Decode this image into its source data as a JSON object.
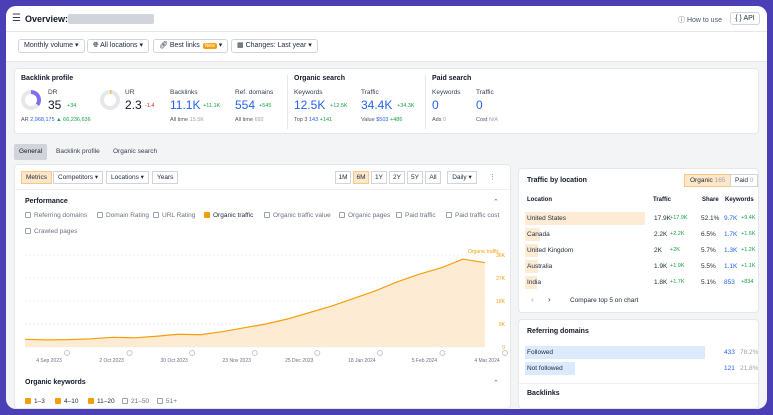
{
  "header": {
    "title": "Overview:",
    "how_to_use": "How to use",
    "api": "{ } API"
  },
  "filters": {
    "volume": "Monthly volume",
    "locations": "All locations",
    "best_links": "Best links",
    "new_badge": "New",
    "changes": "Changes: Last year"
  },
  "backlink_profile": {
    "title": "Backlink profile",
    "dr_label": "DR",
    "dr_value": "35",
    "dr_delta": "+34",
    "ar_label": "AR",
    "ar_value": "2,968,175",
    "ar_delta": "▲ 66,236,636",
    "ur_label": "UR",
    "ur_value": "2.3",
    "ur_delta": "-1.4",
    "backlinks_label": "Backlinks",
    "backlinks_value": "11.1K",
    "backlinks_delta": "+11.1K",
    "backlinks_sub": "All time",
    "backlinks_sub_value": "15.5K",
    "refdomains_label": "Ref. domains",
    "refdomains_value": "554",
    "refdomains_delta": "+545",
    "refdomains_sub": "All time",
    "refdomains_sub_value": "692"
  },
  "organic_search": {
    "title": "Organic search",
    "keywords_label": "Keywords",
    "keywords_value": "12.5K",
    "keywords_delta": "+12.5K",
    "keywords_sub": "Top 3",
    "keywords_sub_value": "143",
    "keywords_sub_delta": "+141",
    "traffic_label": "Traffic",
    "traffic_value": "34.4K",
    "traffic_delta": "+34.3K",
    "traffic_sub": "Value",
    "traffic_sub_value": "$503",
    "traffic_sub_delta": "+486"
  },
  "paid_search": {
    "title": "Paid search",
    "keywords_label": "Keywords",
    "keywords_value": "0",
    "keywords_sub": "Ads",
    "keywords_sub_value": "0",
    "traffic_label": "Traffic",
    "traffic_value": "0",
    "traffic_sub": "Cost",
    "traffic_sub_value": "N/A"
  },
  "tabs": [
    "General",
    "Backlink profile",
    "Organic search"
  ],
  "chart_toolbar": {
    "metrics": "Metrics",
    "competitors": "Competitors",
    "locations": "Locations",
    "years": "Years",
    "ranges": [
      "1M",
      "6M",
      "1Y",
      "2Y",
      "5Y",
      "All"
    ],
    "active_range": "6M",
    "interval": "Daily"
  },
  "performance": {
    "title": "Performance",
    "checkboxes": [
      {
        "label": "Referring domains",
        "checked": false
      },
      {
        "label": "Domain Rating",
        "checked": false
      },
      {
        "label": "URL Rating",
        "checked": false
      },
      {
        "label": "Organic traffic",
        "checked": true
      },
      {
        "label": "Organic traffic value",
        "checked": false
      },
      {
        "label": "Organic pages",
        "checked": false
      },
      {
        "label": "Paid traffic",
        "checked": false
      },
      {
        "label": "Paid traffic cost",
        "checked": false
      },
      {
        "label": "Crawled pages",
        "checked": false
      }
    ]
  },
  "chart_data": {
    "type": "area",
    "series": [
      {
        "name": "Organic traffic",
        "values": [
          3000,
          2800,
          2900,
          3200,
          3800,
          3600,
          4200,
          5000,
          4800,
          6000,
          7500,
          9000,
          11000,
          13500,
          16000,
          19000,
          22000,
          25500,
          28500,
          31000,
          34400,
          33000
        ]
      }
    ],
    "x_ticks": [
      "4 Sep 2023",
      "2 Oct 2023",
      "30 Oct 2023",
      "23 Nov 2023",
      "25 Dec 2023",
      "18 Jan 2024",
      "5 Feb 2024",
      "4 Mar 2024"
    ],
    "y_ticks": [
      "36K",
      "27K",
      "18K",
      "9K",
      "0"
    ],
    "ylim": [
      0,
      36000
    ],
    "color": "#f59e0b",
    "grid": true
  },
  "organic_keywords": {
    "title": "Organic keywords",
    "checkboxes": [
      {
        "label": "1–3",
        "checked": true
      },
      {
        "label": "4–10",
        "checked": true
      },
      {
        "label": "11–20",
        "checked": true
      },
      {
        "label": "21–50",
        "checked": false
      },
      {
        "label": "51+",
        "checked": false
      }
    ]
  },
  "traffic_by_location": {
    "title": "Traffic by location",
    "organic_btn": "Organic",
    "organic_count": "165",
    "paid_btn": "Paid",
    "paid_count": "0",
    "headers": [
      "Location",
      "Traffic",
      "Share",
      "Keywords"
    ],
    "rows": [
      {
        "location": "United States",
        "traffic": "17.9K",
        "traffic_delta": "+17.9K",
        "share": "52.1%",
        "keywords": "9.7K",
        "keywords_delta": "+9.4K",
        "share_fill": 0.521
      },
      {
        "location": "Canada",
        "traffic": "2.2K",
        "traffic_delta": "+2.2K",
        "share": "6.5%",
        "keywords": "1.7K",
        "keywords_delta": "+1.6K",
        "share_fill": 0.065
      },
      {
        "location": "United Kingdom",
        "traffic": "2K",
        "traffic_delta": "+2K",
        "share": "5.7%",
        "keywords": "1.3K",
        "keywords_delta": "+1.2K",
        "share_fill": 0.057
      },
      {
        "location": "Australia",
        "traffic": "1.9K",
        "traffic_delta": "+1.9K",
        "share": "5.5%",
        "keywords": "1.1K",
        "keywords_delta": "+1.1K",
        "share_fill": 0.055
      },
      {
        "location": "India",
        "traffic": "1.8K",
        "traffic_delta": "+1.7K",
        "share": "5.1%",
        "keywords": "853",
        "keywords_delta": "+834",
        "share_fill": 0.051
      }
    ],
    "compare": "Compare top 5 on chart"
  },
  "referring_domains": {
    "title": "Referring domains",
    "rows": [
      {
        "label": "Followed",
        "value": "433",
        "pct": "78.2%",
        "fill": 0.782
      },
      {
        "label": "Not followed",
        "value": "121",
        "pct": "21.8%",
        "fill": 0.218
      }
    ]
  },
  "backlinks_panel": {
    "title": "Backlinks"
  }
}
